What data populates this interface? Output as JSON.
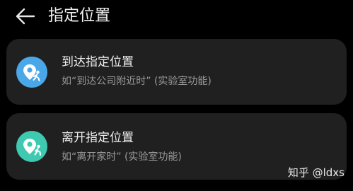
{
  "header": {
    "title": "指定位置",
    "back_icon": "arrow-left-icon"
  },
  "cards": [
    {
      "title": "到达指定位置",
      "subtitle": "如“到达公司附近时” (实验室功能)",
      "icon": "arrive-location-icon",
      "icon_color": "#4aa8e8"
    },
    {
      "title": "离开指定位置",
      "subtitle": "如“离开家时” (实验室功能)",
      "icon": "leave-location-icon",
      "icon_color": "#3ec9b0"
    }
  ],
  "watermark": "知乎 @ldxs",
  "colors": {
    "background": "#000000",
    "card": "#202020",
    "subtitle": "#9a9a9a"
  }
}
